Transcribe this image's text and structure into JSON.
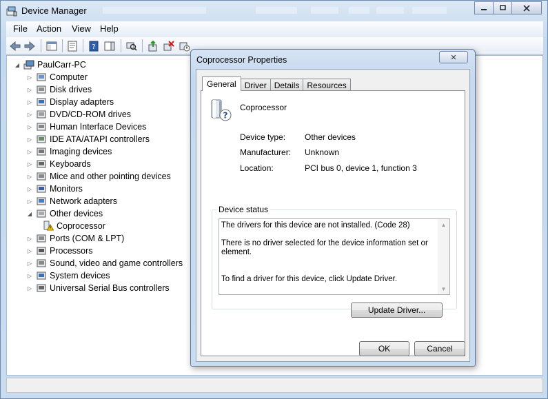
{
  "window": {
    "title": "Device Manager"
  },
  "menu": [
    "File",
    "Action",
    "View",
    "Help"
  ],
  "tree": {
    "root": "PaulCarr-PC",
    "categories": [
      {
        "label": "Computer",
        "icon": "computer-icon"
      },
      {
        "label": "Disk drives",
        "icon": "disk-drive-icon"
      },
      {
        "label": "Display adapters",
        "icon": "display-adapter-icon"
      },
      {
        "label": "DVD/CD-ROM drives",
        "icon": "dvd-drive-icon"
      },
      {
        "label": "Human Interface Devices",
        "icon": "hid-icon"
      },
      {
        "label": "IDE ATA/ATAPI controllers",
        "icon": "ide-controller-icon"
      },
      {
        "label": "Imaging devices",
        "icon": "camera-icon"
      },
      {
        "label": "Keyboards",
        "icon": "keyboard-icon"
      },
      {
        "label": "Mice and other pointing devices",
        "icon": "mouse-icon"
      },
      {
        "label": "Monitors",
        "icon": "monitor-icon"
      },
      {
        "label": "Network adapters",
        "icon": "network-adapter-icon"
      },
      {
        "label": "Other devices",
        "icon": "unknown-device-icon",
        "expanded": true
      },
      {
        "label": "Coprocessor",
        "icon": "warning-device-icon",
        "child": true
      },
      {
        "label": "Ports (COM & LPT)",
        "icon": "port-icon"
      },
      {
        "label": "Processors",
        "icon": "processor-icon"
      },
      {
        "label": "Sound, video and game controllers",
        "icon": "speaker-icon"
      },
      {
        "label": "System devices",
        "icon": "system-device-icon"
      },
      {
        "label": "Universal Serial Bus controllers",
        "icon": "usb-icon"
      }
    ]
  },
  "dialog": {
    "title": "Coprocessor Properties",
    "close_glyph": "✕",
    "tabs": [
      "General",
      "Driver",
      "Details",
      "Resources"
    ],
    "device_name": "Coprocessor",
    "fields": [
      {
        "label": "Device type:",
        "value": "Other devices"
      },
      {
        "label": "Manufacturer:",
        "value": "Unknown"
      },
      {
        "label": "Location:",
        "value": "PCI bus 0, device 1, function 3"
      }
    ],
    "status_legend": "Device status",
    "status_lines": [
      "The drivers for this device are not installed. (Code 28)",
      "There is no driver selected for the device information set or element.",
      "To find a driver for this device, click Update Driver."
    ],
    "update_button": "Update Driver...",
    "ok_button": "OK",
    "cancel_button": "Cancel"
  },
  "colors": {
    "accent": "#c5d9ee",
    "tree_selected": "#ffffff"
  }
}
